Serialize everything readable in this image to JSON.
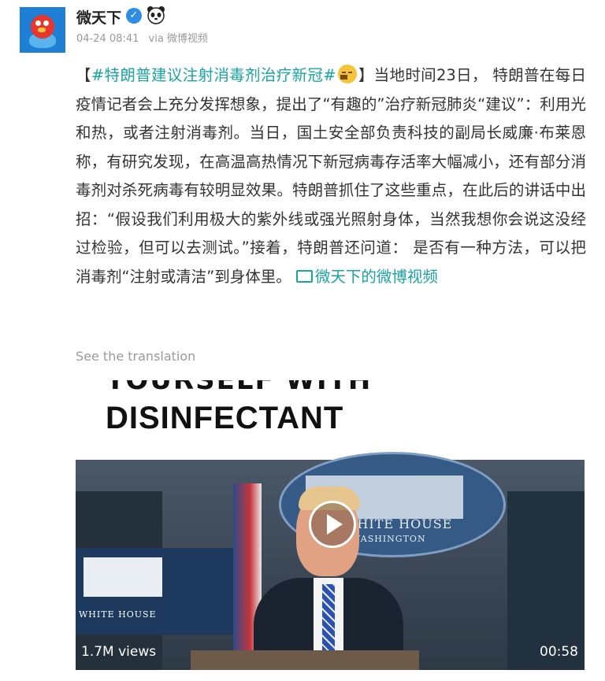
{
  "header": {
    "account_name": "微天下",
    "timestamp": "04-24 08:41",
    "source": "via 微博视频",
    "verified_icon": "verified-check-icon",
    "badge_icon": "panda-icon"
  },
  "post": {
    "topic_open": "【",
    "topic": "#特朗普建议注射消毒剂治疗新冠#",
    "topic_close": "】",
    "body": "当地时间23日， 特朗普在每日疫情记者会上充分发挥想象，提出了“有趣的”治疗新冠肺炎“建议”：利用光和热，或者注射消毒剂。当日，国土安全部负责科技的副局长威廉·布莱恩称，有研究发现，在高温高热情况下新冠病毒存活率大幅减小，还有部分消毒剂对杀死病毒有较明显效果。特朗普抓住了这些重点，在此后的讲话中出招：“假设我们利用极大的紫外线或强光照射身体，当然我想你会说这没经过检验，但可以去测试。”接着，特朗普还问道： 是否有一种方法，可以把消毒剂“注射或清洁”到身体里。",
    "video_link": "微天下的微博视频",
    "translate": "See the translation"
  },
  "video": {
    "caption_clipped": "YOURSELF WITH",
    "caption_main": "DISINFECTANT",
    "seal_text": "WHITE HOUSE",
    "seal_subtext": "WASHINGTON",
    "podium_text": "WHITE HOUSE",
    "views": "1.7M views",
    "duration": "00:58"
  },
  "colors": {
    "accent": "#1aa3a3",
    "verified": "#2f8de4",
    "meta": "#9a9a9a"
  }
}
